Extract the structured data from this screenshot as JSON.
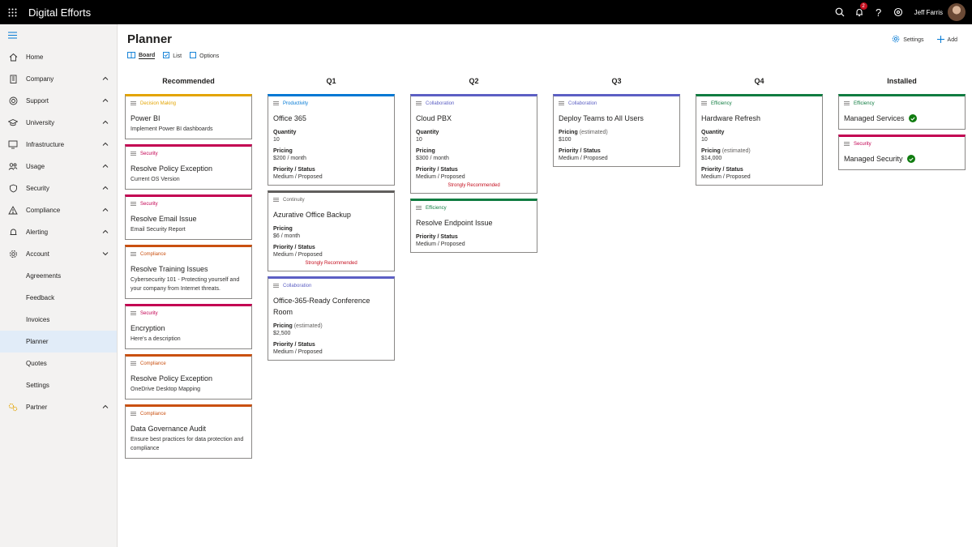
{
  "app": {
    "title": "Digital Efforts",
    "user_name": "Jeff Farris",
    "notification_count": "2"
  },
  "sidebar": {
    "items": [
      {
        "label": "Home"
      },
      {
        "label": "Company"
      },
      {
        "label": "Support"
      },
      {
        "label": "University"
      },
      {
        "label": "Infrastructure"
      },
      {
        "label": "Usage"
      },
      {
        "label": "Security"
      },
      {
        "label": "Compliance"
      },
      {
        "label": "Alerting"
      },
      {
        "label": "Account"
      }
    ],
    "account_sub": [
      "Agreements",
      "Feedback",
      "Invoices",
      "Planner",
      "Quotes",
      "Settings"
    ],
    "partner": "Partner"
  },
  "page": {
    "title": "Planner",
    "tabs": {
      "board": "Board",
      "list": "List",
      "options": "Options"
    },
    "settings_label": "Settings",
    "add_label": "Add"
  },
  "labels": {
    "quantity": "Quantity",
    "pricing": "Pricing",
    "estimated": "(estimated)",
    "priority_status": "Priority / Status",
    "strongly_recommended": "Strongly Recommended"
  },
  "colors": {
    "decision": "#e3a400",
    "security": "#c30052",
    "compliance": "#ca5010",
    "productivity": "#0078d4",
    "collaboration": "#5c5fc4",
    "continuity": "#605e5c",
    "efficiency": "#107c41"
  },
  "columns": {
    "recommended": {
      "title": "Recommended",
      "cards": [
        {
          "category": "Decision Making",
          "title": "Power BI",
          "desc": "Implement Power BI dashboards"
        },
        {
          "category": "Security",
          "title": "Resolve Policy Exception",
          "desc": "Current OS Version"
        },
        {
          "category": "Security",
          "title": "Resolve Email Issue",
          "desc": "Email Security Report"
        },
        {
          "category": "Compliance",
          "title": "Resolve Training Issues",
          "desc": "Cybersecurity 101 - Protecting yourself and your company from Internet threats."
        },
        {
          "category": "Security",
          "title": "Encryption",
          "desc": "Here's a description"
        },
        {
          "category": "Compliance",
          "title": "Resolve Policy Exception",
          "desc": "OneDrive Desktop Mapping"
        },
        {
          "category": "Compliance",
          "title": "Data Governance Audit",
          "desc": "Ensure best practices for data protection and compliance"
        }
      ]
    },
    "q1": {
      "title": "Q1",
      "cards": [
        {
          "category": "Productivity",
          "title": "Office 365",
          "quantity": "10",
          "pricing": "$200 / month",
          "status": "Medium / Proposed"
        },
        {
          "category": "Continuity",
          "title": "Azurative Office Backup",
          "pricing": "$6 / month",
          "status": "Medium / Proposed"
        },
        {
          "category": "Collaboration",
          "title": "Office-365-Ready Conference Room",
          "pricing": "$2,500",
          "status": "Medium / Proposed"
        }
      ]
    },
    "q2": {
      "title": "Q2",
      "cards": [
        {
          "category": "Collaboration",
          "title": "Cloud PBX",
          "quantity": "10",
          "pricing": "$300 / month",
          "status": "Medium / Proposed"
        },
        {
          "category": "Efficiency",
          "title": "Resolve Endpoint Issue",
          "status": "Medium / Proposed"
        }
      ]
    },
    "q3": {
      "title": "Q3",
      "cards": [
        {
          "category": "Collaboration",
          "title": "Deploy Teams to All Users",
          "pricing": "$100",
          "status": "Medium / Proposed"
        }
      ]
    },
    "q4": {
      "title": "Q4",
      "cards": [
        {
          "category": "Efficiency",
          "title": "Hardware Refresh",
          "quantity": "10",
          "pricing": "$14,000",
          "status": "Medium / Proposed"
        }
      ]
    },
    "installed": {
      "title": "Installed",
      "cards": [
        {
          "category": "Efficiency",
          "title": "Managed Services"
        },
        {
          "category": "Security",
          "title": "Managed Security"
        }
      ]
    }
  }
}
